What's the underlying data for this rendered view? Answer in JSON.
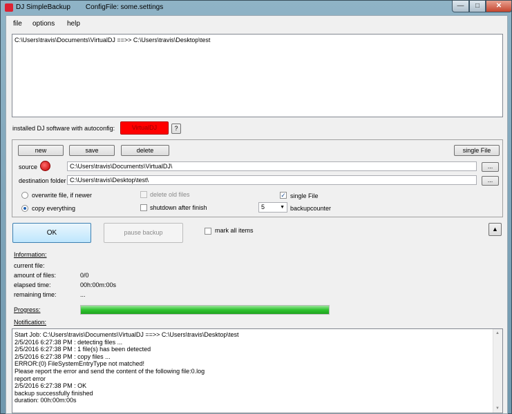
{
  "window": {
    "app_title": "DJ SimpleBackup",
    "config_label": "ConfigFile: some.settings",
    "minimize_glyph": "—",
    "maximize_glyph": "□",
    "close_glyph": "✕"
  },
  "menu": {
    "file": "file",
    "options": "options",
    "help": "help"
  },
  "jobs_list": [
    "C:\\Users\\travis\\Documents\\VirtualDJ  ==>>  C:\\Users\\travis\\Desktop\\test"
  ],
  "autoconfig": {
    "label": "installed DJ software with autoconfig:",
    "software_button": "VirtualDJ",
    "software_color": "#ff0000",
    "help_button": "?"
  },
  "job_editor": {
    "new": "new",
    "save": "save",
    "delete": "delete",
    "single_file_button": "single File",
    "source_label": "source",
    "source_value": "C:\\Users\\travis\\Documents\\VirtualDJ\\",
    "browse": "...",
    "destination_label": "destination folder",
    "destination_value": "C:\\Users\\travis\\Desktop\\test\\",
    "overwrite_option": "overwrite file, if newer",
    "copy_option": "copy everything",
    "delete_old_files": "delete old files",
    "shutdown_after_finish": "shutdown after finish",
    "single_file_checkbox": "single File",
    "backupcounter_value": "5",
    "backupcounter_label": "backupcounter"
  },
  "actions": {
    "ok": "OK",
    "pause": "pause backup",
    "mark_all": "mark all items",
    "collapse": "▲"
  },
  "information": {
    "heading": "Information:",
    "current_file_label": "current file:",
    "current_file_value": "",
    "amount_label": "amount of files:",
    "amount_value": "0/0",
    "elapsed_label": "elapsed time:",
    "elapsed_value": "00h:00m:00s",
    "remaining_label": "remaining time:",
    "remaining_value": "..."
  },
  "progress": {
    "label": "Progress:",
    "fraction": 1.0,
    "color": "#2fc42f"
  },
  "notification": {
    "label": "Notification:",
    "lines": [
      "Start Job: C:\\Users\\travis\\Documents\\VirtualDJ  ==>>  C:\\Users\\travis\\Desktop\\test",
      "2/5/2016 6:27:38 PM : detecting files ...",
      "2/5/2016 6:27:38 PM : 1 file(s) has been detected",
      "2/5/2016 6:27:38 PM : copy files ...",
      "ERROR:(0) FileSystemEntryType not matched!",
      "Please report the error and send the content of the following file:0.log",
      "report error",
      "2/5/2016 6:27:38 PM : OK",
      "backup successfully finished",
      "duration: 00h:00m:00s"
    ]
  }
}
